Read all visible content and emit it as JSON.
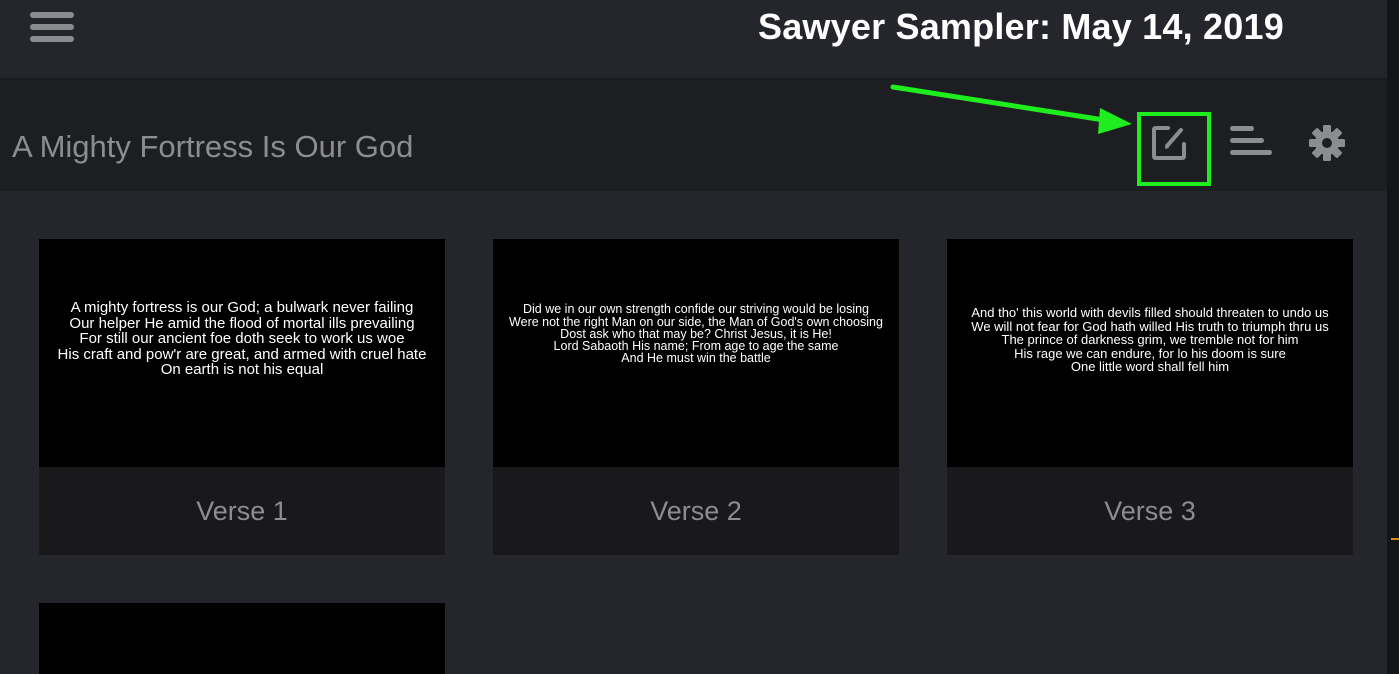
{
  "header": {
    "menu_icon": "hamburger-menu-icon",
    "overlay_title": "Sawyer Sampler: May 14, 2019"
  },
  "song": {
    "title": "A Mighty Fortress Is Our God",
    "tools": [
      {
        "name": "edit-icon"
      },
      {
        "name": "arrange-icon"
      },
      {
        "name": "gear-icon"
      }
    ]
  },
  "annotation": {
    "highlight_color": "#1eee1e"
  },
  "slides": [
    {
      "label": "Verse 1",
      "lines": [
        "A mighty fortress is our God; a bulwark never failing",
        "Our helper He amid the flood of mortal ills prevailing",
        "For still our ancient foe doth seek to work us woe",
        "His craft and pow'r are great, and armed with cruel hate",
        "On earth is not his equal"
      ]
    },
    {
      "label": "Verse 2",
      "lines": [
        "Did we in our own strength confide our striving would be losing",
        "Were not the right Man on our side, the Man of God's own choosing",
        "Dost ask who that may be? Christ Jesus, it is He!",
        "Lord Sabaoth His name; From age to age the same",
        "And He must win the battle"
      ]
    },
    {
      "label": "Verse 3",
      "lines": [
        "And tho' this world with devils filled should threaten to undo us",
        "We will not fear for God hath willed His truth to triumph thru us",
        "The prince of darkness grim, we tremble not for him",
        "His rage we can endure, for lo his doom is sure",
        "One little word shall fell him"
      ]
    }
  ],
  "colors": {
    "background": "#25262b",
    "song_bar": "#1d1e21",
    "slide_background": "#000000",
    "muted_text": "#8c8d90"
  }
}
